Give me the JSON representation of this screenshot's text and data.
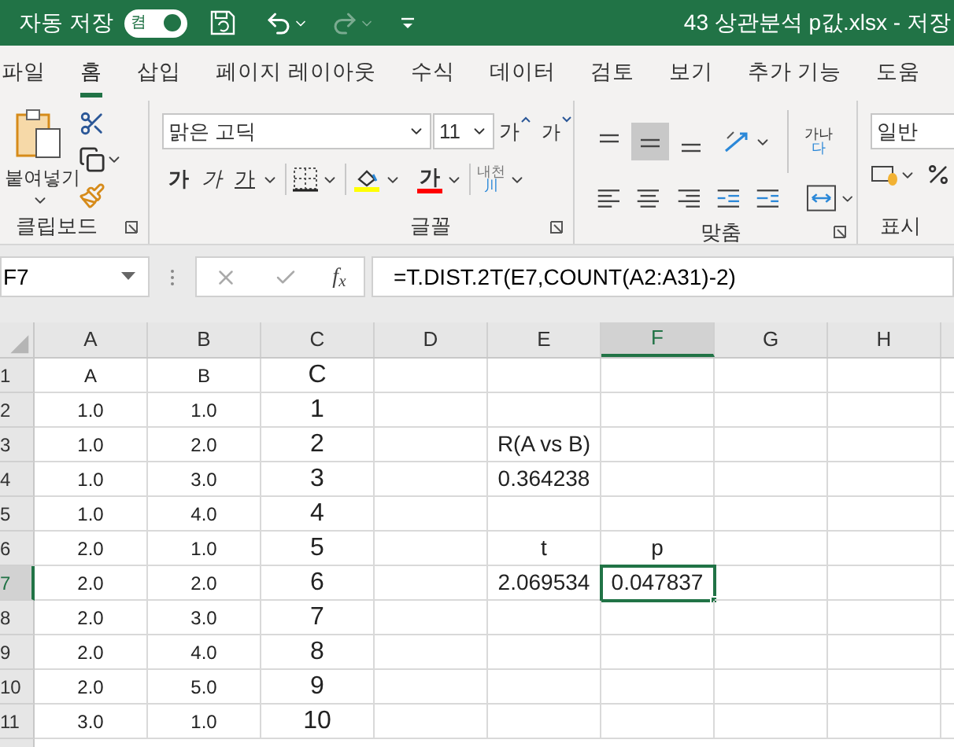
{
  "title_bar": {
    "autosave_label": "자동 저장",
    "autosave_toggle": {
      "label": "켬",
      "on": true
    },
    "redo_disabled": true,
    "file_title": "43 상관분석 p값.xlsx - 저장"
  },
  "tabs": [
    {
      "label": "파일",
      "selected": false
    },
    {
      "label": "홈",
      "selected": true
    },
    {
      "label": "삽입",
      "selected": false
    },
    {
      "label": "페이지 레이아웃",
      "selected": false
    },
    {
      "label": "수식",
      "selected": false
    },
    {
      "label": "데이터",
      "selected": false
    },
    {
      "label": "검토",
      "selected": false
    },
    {
      "label": "보기",
      "selected": false
    },
    {
      "label": "추가 기능",
      "selected": false
    },
    {
      "label": "도움",
      "selected": false
    }
  ],
  "ribbon": {
    "clipboard": {
      "paste_label": "붙여넣기",
      "group_label": "클립보드"
    },
    "font": {
      "font_name": "맑은 고딕",
      "font_size": "11",
      "grow_label": "가",
      "shrink_label": "가",
      "bold_label": "가",
      "italic_label": "가",
      "underline_label": "가",
      "font_color_label": "가",
      "phonetic_top": "내천",
      "phonetic_bottom": "川",
      "group_label": "글꼴"
    },
    "alignment": {
      "vertical_align": [
        {
          "selected": false
        },
        {
          "selected": true
        },
        {
          "selected": false
        }
      ],
      "wrap_top": "가나",
      "wrap_bottom": "다",
      "group_label": "맞춤"
    },
    "number": {
      "format": "일반",
      "group_label": "표시"
    }
  },
  "formula_bar": {
    "name_box": "F7",
    "fx_label": "f$_{x}$",
    "formula": "=T.DIST.2T(E7,COUNT(A2:A31)-2)"
  },
  "sheet": {
    "columns": [
      {
        "label": "A",
        "selected": false
      },
      {
        "label": "B",
        "selected": false
      },
      {
        "label": "C",
        "selected": false
      },
      {
        "label": "D",
        "selected": false
      },
      {
        "label": "E",
        "selected": false
      },
      {
        "label": "F",
        "selected": true
      },
      {
        "label": "G",
        "selected": false
      },
      {
        "label": "H",
        "selected": false
      }
    ],
    "rows": [
      {
        "header": "1",
        "selected": false,
        "cells": [
          "A",
          "B",
          "C",
          null,
          null,
          null,
          null,
          null
        ]
      },
      {
        "header": "2",
        "selected": false,
        "cells": [
          "1.0",
          "1.0",
          "1",
          null,
          null,
          null,
          null,
          null
        ]
      },
      {
        "header": "3",
        "selected": false,
        "cells": [
          "1.0",
          "2.0",
          "2",
          null,
          "R(A vs B)",
          null,
          null,
          null
        ]
      },
      {
        "header": "4",
        "selected": false,
        "cells": [
          "1.0",
          "3.0",
          "3",
          null,
          "0.364238",
          null,
          null,
          null
        ]
      },
      {
        "header": "5",
        "selected": false,
        "cells": [
          "1.0",
          "4.0",
          "4",
          null,
          null,
          null,
          null,
          null
        ]
      },
      {
        "header": "6",
        "selected": false,
        "cells": [
          "2.0",
          "1.0",
          "5",
          null,
          "t",
          "p",
          null,
          null
        ]
      },
      {
        "header": "7",
        "selected": true,
        "cells": [
          "2.0",
          "2.0",
          "6",
          null,
          "2.069534",
          "0.047837",
          null,
          null
        ]
      },
      {
        "header": "8",
        "selected": false,
        "cells": [
          "2.0",
          "3.0",
          "7",
          null,
          null,
          null,
          null,
          null
        ]
      },
      {
        "header": "9",
        "selected": false,
        "cells": [
          "2.0",
          "4.0",
          "8",
          null,
          null,
          null,
          null,
          null
        ]
      },
      {
        "header": "10",
        "selected": false,
        "cells": [
          "2.0",
          "5.0",
          "9",
          null,
          null,
          null,
          null,
          null
        ]
      },
      {
        "header": "11",
        "selected": false,
        "cells": [
          "3.0",
          "1.0",
          "10",
          null,
          null,
          null,
          null,
          null
        ]
      }
    ]
  }
}
